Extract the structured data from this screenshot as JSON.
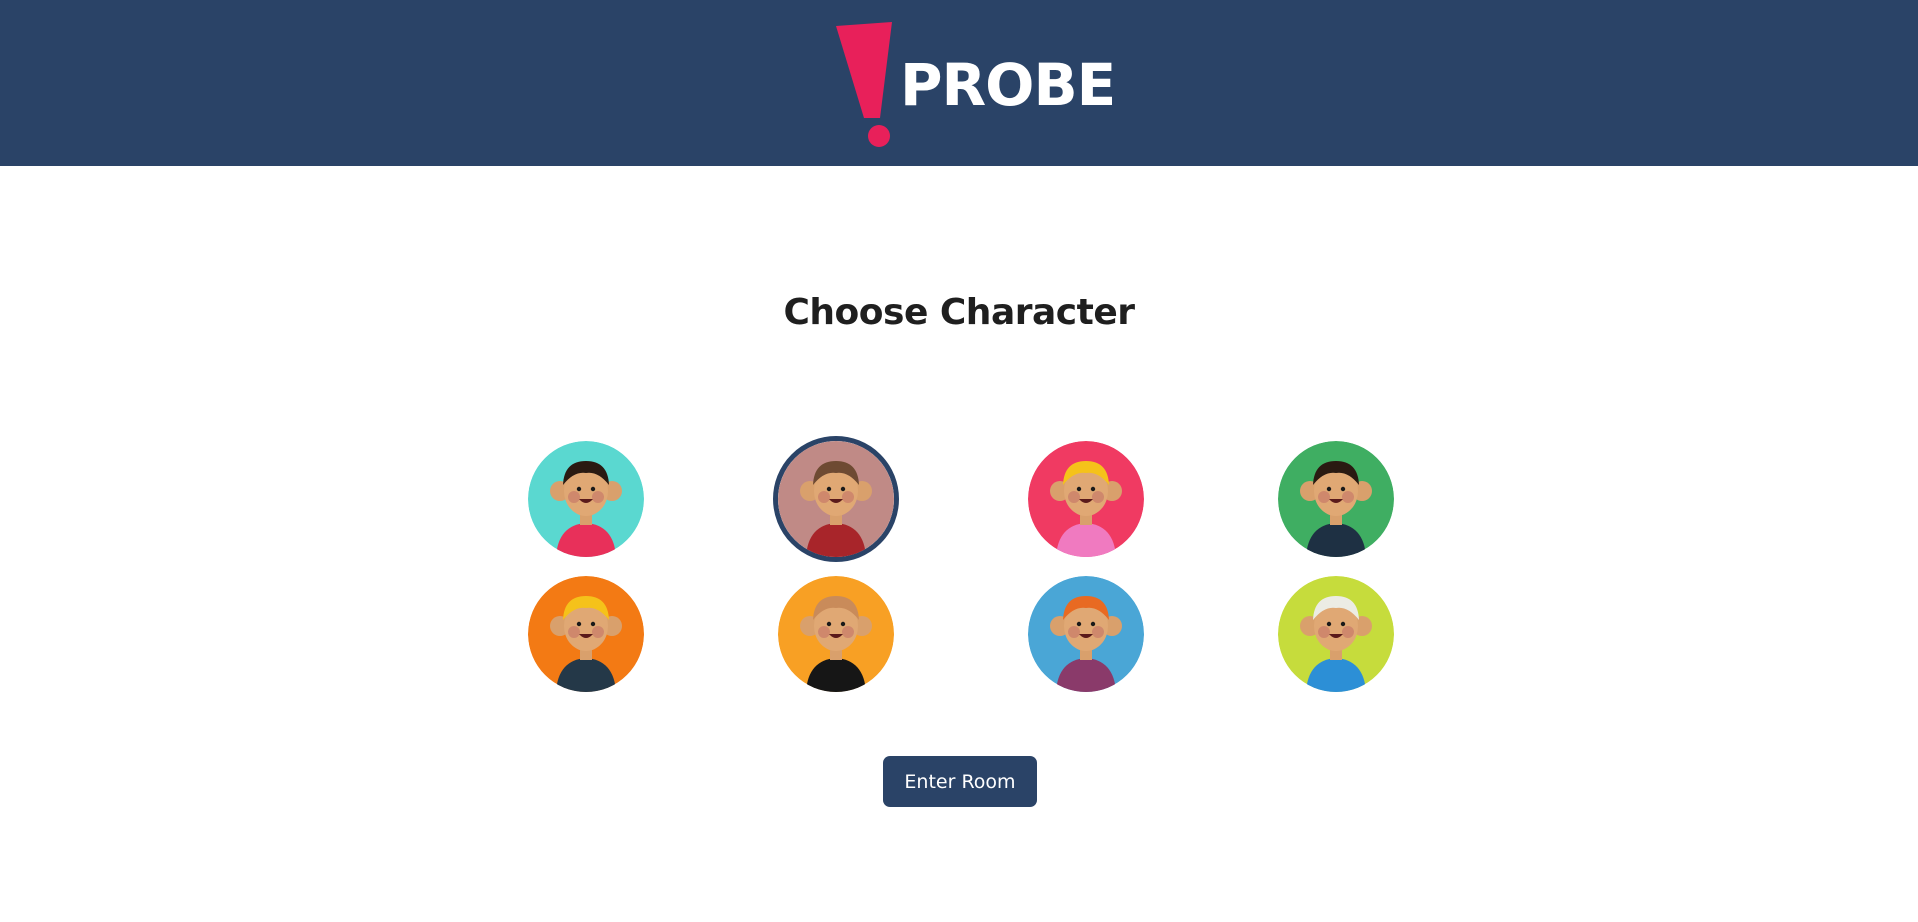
{
  "header": {
    "logo_text": "PROBE",
    "logo_mark": "exclamation-mark-icon"
  },
  "main": {
    "title": "Choose Character",
    "enter_button_label": "Enter Room"
  },
  "characters": [
    {
      "name": "curly-hair-girl",
      "bg": "#5ad8d0",
      "shirt": "#e8305a",
      "hair": "#2a1a12",
      "selected": false
    },
    {
      "name": "sunglasses-girl",
      "bg": "#c08a86",
      "shirt": "#a8252a",
      "hair": "#6e4a32",
      "selected": true
    },
    {
      "name": "heart-glasses-girl",
      "bg": "#f03a62",
      "shirt": "#f07ac0",
      "hair": "#f5c21a",
      "selected": false
    },
    {
      "name": "boy-red-cap",
      "bg": "#3fae62",
      "shirt": "#1e3043",
      "hair": "#2a1a12",
      "selected": false
    },
    {
      "name": "blonde-boy-heart-shirt",
      "bg": "#f37a14",
      "shirt": "#243848",
      "hair": "#f5c21a",
      "selected": false
    },
    {
      "name": "bald-kid-star-shirt",
      "bg": "#f8a024",
      "shirt": "#161616",
      "hair": "#c98b5a",
      "selected": false
    },
    {
      "name": "redhead-girl-flower",
      "bg": "#4aa6d6",
      "shirt": "#8a3a6a",
      "hair": "#e86a22",
      "selected": false
    },
    {
      "name": "white-hair-kid-scarf",
      "bg": "#c6dc3c",
      "shirt": "#2c8fd6",
      "hair": "#ecece4",
      "selected": false
    }
  ],
  "colors": {
    "header_bg": "#2a4367",
    "accent": "#e8205a",
    "button_bg": "#2a4367"
  }
}
